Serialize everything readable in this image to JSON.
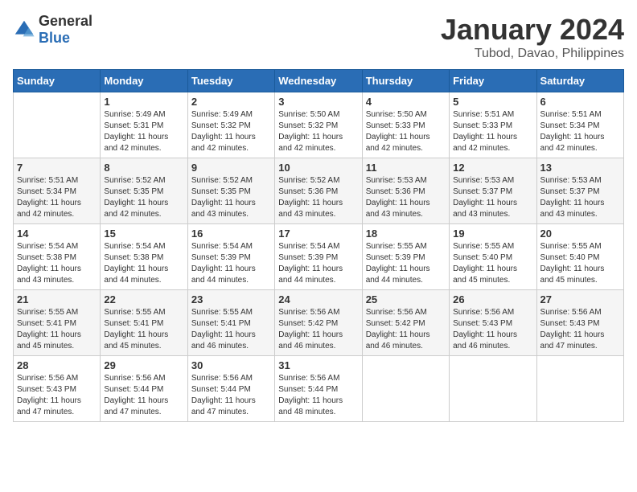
{
  "header": {
    "logo_general": "General",
    "logo_blue": "Blue",
    "month_title": "January 2024",
    "location": "Tubod, Davao, Philippines"
  },
  "days_of_week": [
    "Sunday",
    "Monday",
    "Tuesday",
    "Wednesday",
    "Thursday",
    "Friday",
    "Saturday"
  ],
  "weeks": [
    [
      {
        "num": "",
        "info": ""
      },
      {
        "num": "1",
        "info": "Sunrise: 5:49 AM\nSunset: 5:31 PM\nDaylight: 11 hours\nand 42 minutes."
      },
      {
        "num": "2",
        "info": "Sunrise: 5:49 AM\nSunset: 5:32 PM\nDaylight: 11 hours\nand 42 minutes."
      },
      {
        "num": "3",
        "info": "Sunrise: 5:50 AM\nSunset: 5:32 PM\nDaylight: 11 hours\nand 42 minutes."
      },
      {
        "num": "4",
        "info": "Sunrise: 5:50 AM\nSunset: 5:33 PM\nDaylight: 11 hours\nand 42 minutes."
      },
      {
        "num": "5",
        "info": "Sunrise: 5:51 AM\nSunset: 5:33 PM\nDaylight: 11 hours\nand 42 minutes."
      },
      {
        "num": "6",
        "info": "Sunrise: 5:51 AM\nSunset: 5:34 PM\nDaylight: 11 hours\nand 42 minutes."
      }
    ],
    [
      {
        "num": "7",
        "info": "Sunrise: 5:51 AM\nSunset: 5:34 PM\nDaylight: 11 hours\nand 42 minutes."
      },
      {
        "num": "8",
        "info": "Sunrise: 5:52 AM\nSunset: 5:35 PM\nDaylight: 11 hours\nand 42 minutes."
      },
      {
        "num": "9",
        "info": "Sunrise: 5:52 AM\nSunset: 5:35 PM\nDaylight: 11 hours\nand 43 minutes."
      },
      {
        "num": "10",
        "info": "Sunrise: 5:52 AM\nSunset: 5:36 PM\nDaylight: 11 hours\nand 43 minutes."
      },
      {
        "num": "11",
        "info": "Sunrise: 5:53 AM\nSunset: 5:36 PM\nDaylight: 11 hours\nand 43 minutes."
      },
      {
        "num": "12",
        "info": "Sunrise: 5:53 AM\nSunset: 5:37 PM\nDaylight: 11 hours\nand 43 minutes."
      },
      {
        "num": "13",
        "info": "Sunrise: 5:53 AM\nSunset: 5:37 PM\nDaylight: 11 hours\nand 43 minutes."
      }
    ],
    [
      {
        "num": "14",
        "info": "Sunrise: 5:54 AM\nSunset: 5:38 PM\nDaylight: 11 hours\nand 43 minutes."
      },
      {
        "num": "15",
        "info": "Sunrise: 5:54 AM\nSunset: 5:38 PM\nDaylight: 11 hours\nand 44 minutes."
      },
      {
        "num": "16",
        "info": "Sunrise: 5:54 AM\nSunset: 5:39 PM\nDaylight: 11 hours\nand 44 minutes."
      },
      {
        "num": "17",
        "info": "Sunrise: 5:54 AM\nSunset: 5:39 PM\nDaylight: 11 hours\nand 44 minutes."
      },
      {
        "num": "18",
        "info": "Sunrise: 5:55 AM\nSunset: 5:39 PM\nDaylight: 11 hours\nand 44 minutes."
      },
      {
        "num": "19",
        "info": "Sunrise: 5:55 AM\nSunset: 5:40 PM\nDaylight: 11 hours\nand 45 minutes."
      },
      {
        "num": "20",
        "info": "Sunrise: 5:55 AM\nSunset: 5:40 PM\nDaylight: 11 hours\nand 45 minutes."
      }
    ],
    [
      {
        "num": "21",
        "info": "Sunrise: 5:55 AM\nSunset: 5:41 PM\nDaylight: 11 hours\nand 45 minutes."
      },
      {
        "num": "22",
        "info": "Sunrise: 5:55 AM\nSunset: 5:41 PM\nDaylight: 11 hours\nand 45 minutes."
      },
      {
        "num": "23",
        "info": "Sunrise: 5:55 AM\nSunset: 5:41 PM\nDaylight: 11 hours\nand 46 minutes."
      },
      {
        "num": "24",
        "info": "Sunrise: 5:56 AM\nSunset: 5:42 PM\nDaylight: 11 hours\nand 46 minutes."
      },
      {
        "num": "25",
        "info": "Sunrise: 5:56 AM\nSunset: 5:42 PM\nDaylight: 11 hours\nand 46 minutes."
      },
      {
        "num": "26",
        "info": "Sunrise: 5:56 AM\nSunset: 5:43 PM\nDaylight: 11 hours\nand 46 minutes."
      },
      {
        "num": "27",
        "info": "Sunrise: 5:56 AM\nSunset: 5:43 PM\nDaylight: 11 hours\nand 47 minutes."
      }
    ],
    [
      {
        "num": "28",
        "info": "Sunrise: 5:56 AM\nSunset: 5:43 PM\nDaylight: 11 hours\nand 47 minutes."
      },
      {
        "num": "29",
        "info": "Sunrise: 5:56 AM\nSunset: 5:44 PM\nDaylight: 11 hours\nand 47 minutes."
      },
      {
        "num": "30",
        "info": "Sunrise: 5:56 AM\nSunset: 5:44 PM\nDaylight: 11 hours\nand 47 minutes."
      },
      {
        "num": "31",
        "info": "Sunrise: 5:56 AM\nSunset: 5:44 PM\nDaylight: 11 hours\nand 48 minutes."
      },
      {
        "num": "",
        "info": ""
      },
      {
        "num": "",
        "info": ""
      },
      {
        "num": "",
        "info": ""
      }
    ]
  ]
}
